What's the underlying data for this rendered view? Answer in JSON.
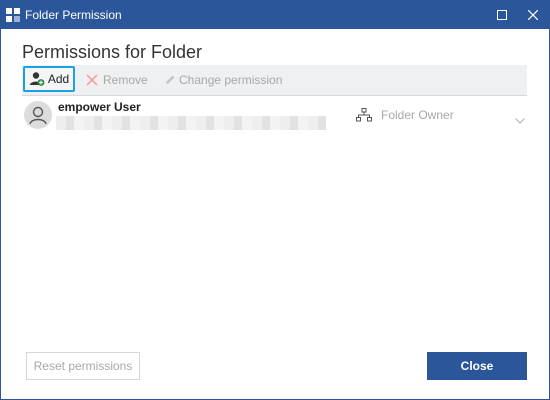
{
  "window": {
    "title": "Folder Permission",
    "title_bar_color": "#2b579a"
  },
  "heading": "Permissions for Folder",
  "toolbar": {
    "add_label": "Add",
    "remove_label": "Remove",
    "change_label": "Change permission"
  },
  "permissions": [
    {
      "user_name": "empower User",
      "detail": "",
      "role": "Folder Owner"
    }
  ],
  "footer": {
    "reset_label": "Reset permissions",
    "close_label": "Close"
  },
  "colors": {
    "accent": "#2b579a",
    "focus_ring": "#1aa1e2",
    "disabled_text": "#a8a8a8"
  }
}
